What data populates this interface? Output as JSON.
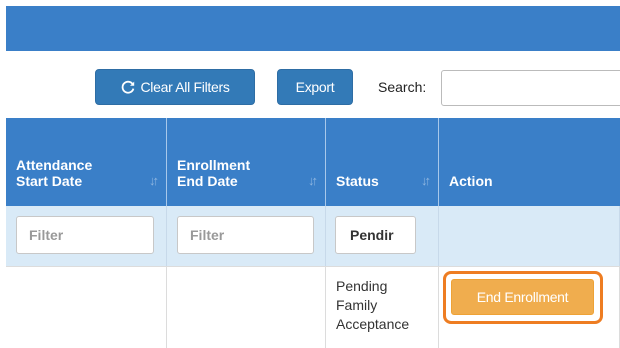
{
  "toolbar": {
    "clear_filters_label": "Clear All Filters",
    "export_label": "Export",
    "search_label": "Search:",
    "search_value": ""
  },
  "table": {
    "columns": [
      {
        "label_line1": "Attendance",
        "label_line2": "Start Date",
        "sortable": true
      },
      {
        "label_line1": "Enrollment",
        "label_line2": "End Date",
        "sortable": true
      },
      {
        "label_line1": "",
        "label_line2": "Status",
        "sortable": true
      },
      {
        "label_line1": "",
        "label_line2": "Action",
        "sortable": false
      }
    ],
    "filters": [
      {
        "placeholder": "Filter",
        "value": ""
      },
      {
        "placeholder": "Filter",
        "value": ""
      },
      {
        "placeholder": "Filter",
        "value": "Pendir"
      }
    ],
    "rows": [
      {
        "attendance_start_date": "",
        "enrollment_end_date": "",
        "status": "Pending Family Acceptance",
        "action_label": "End Enrollment"
      }
    ]
  },
  "colors": {
    "primary": "#337ab7",
    "header": "#3a7fc8",
    "filter_row": "#d9eaf7",
    "warning": "#f0ad4e",
    "highlight_outline": "#ee7d22"
  },
  "icons": {
    "clear_filters": "refresh-icon",
    "sort": "sort-icon"
  }
}
